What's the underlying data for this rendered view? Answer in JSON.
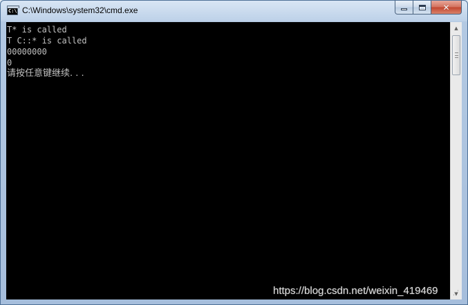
{
  "window": {
    "title": "C:\\Windows\\system32\\cmd.exe",
    "icon": "cmd-icon"
  },
  "caption_buttons": {
    "minimize": "minimize-icon",
    "maximize": "maximize-icon",
    "close": "close-icon",
    "close_glyph": "✕"
  },
  "console": {
    "lines": [
      "T* is called",
      "T C::* is called",
      "00000000",
      "0",
      "请按任意键继续. . ."
    ],
    "background": "#000000",
    "foreground": "#c0c0c0"
  },
  "scrollbar": {
    "up_glyph": "▲",
    "down_glyph": "▼"
  },
  "watermark": "https://blog.csdn.net/weixin_419469"
}
